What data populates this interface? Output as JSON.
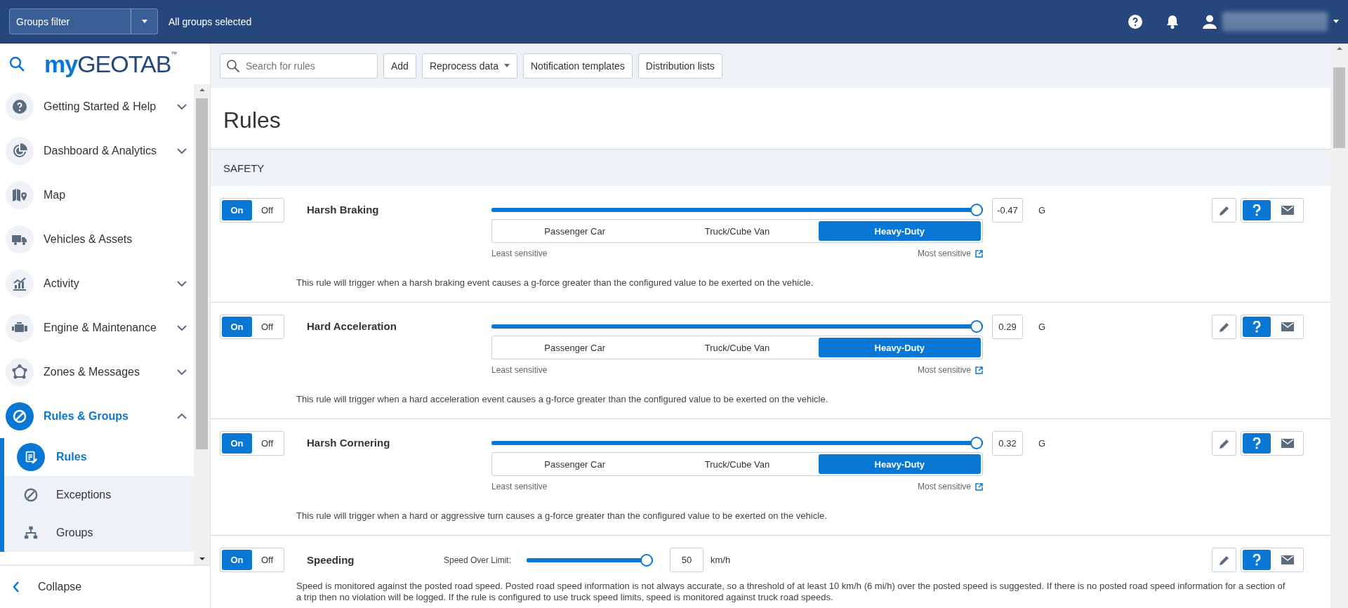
{
  "top_bar": {
    "groups_filter": "Groups filter",
    "groups_status": "All groups selected"
  },
  "sidebar": {
    "logo": {
      "prefix": "my",
      "name": "GEOTAB",
      "mark": "™"
    },
    "items": [
      {
        "label": "Getting Started & Help",
        "expandable": true,
        "expanded": false,
        "selected": false
      },
      {
        "label": "Dashboard & Analytics",
        "expandable": true,
        "expanded": false,
        "selected": false
      },
      {
        "label": "Map",
        "expandable": false,
        "selected": false
      },
      {
        "label": "Vehicles & Assets",
        "expandable": false,
        "selected": false
      },
      {
        "label": "Activity",
        "expandable": true,
        "expanded": false,
        "selected": false
      },
      {
        "label": "Engine & Maintenance",
        "expandable": true,
        "expanded": false,
        "selected": false
      },
      {
        "label": "Zones & Messages",
        "expandable": true,
        "expanded": false,
        "selected": false
      },
      {
        "label": "Rules & Groups",
        "expandable": true,
        "expanded": true,
        "selected": true,
        "children": [
          {
            "label": "Rules",
            "selected": true
          },
          {
            "label": "Exceptions",
            "selected": false
          },
          {
            "label": "Groups",
            "selected": false
          }
        ]
      }
    ],
    "collapse": "Collapse"
  },
  "toolbar": {
    "search": {
      "placeholder": "Search for rules"
    },
    "buttons": [
      {
        "label": "Add",
        "dropdown": false
      },
      {
        "label": "Reprocess data",
        "dropdown": true
      },
      {
        "label": "Notification templates",
        "dropdown": false
      },
      {
        "label": "Distribution lists",
        "dropdown": false
      }
    ]
  },
  "page_title": "Rules",
  "section": "SAFETY",
  "rules": [
    {
      "kind": "vehicle",
      "name": "Harsh Braking",
      "on": true,
      "on_label": "On",
      "off_label": "Off",
      "level": 1,
      "value": "-0.47",
      "unit": "G",
      "vehicle_types": [
        {
          "label": "Passenger Car",
          "selected": false
        },
        {
          "label": "Truck/Cube Van",
          "selected": false
        },
        {
          "label": "Heavy-Duty",
          "selected": true
        }
      ],
      "least_label": "Least sensitive",
      "most_label": "Most sensitive",
      "description": "This rule will trigger when a harsh braking event causes a g-force greater than the configured value to be exerted on the vehicle."
    },
    {
      "kind": "vehicle",
      "name": "Hard Acceleration",
      "on": true,
      "on_label": "On",
      "off_label": "Off",
      "level": 1,
      "value": "0.29",
      "unit": "G",
      "vehicle_types": [
        {
          "label": "Passenger Car",
          "selected": false
        },
        {
          "label": "Truck/Cube Van",
          "selected": false
        },
        {
          "label": "Heavy-Duty",
          "selected": true
        }
      ],
      "least_label": "Least sensitive",
      "most_label": "Most sensitive",
      "description": "This rule will trigger when a hard acceleration event causes a g-force greater than the configured value to be exerted on the vehicle."
    },
    {
      "kind": "vehicle",
      "name": "Harsh Cornering",
      "on": true,
      "on_label": "On",
      "off_label": "Off",
      "level": 1,
      "value": "0.32",
      "unit": "G",
      "vehicle_types": [
        {
          "label": "Passenger Car",
          "selected": false
        },
        {
          "label": "Truck/Cube Van",
          "selected": false
        },
        {
          "label": "Heavy-Duty",
          "selected": true
        }
      ],
      "least_label": "Least sensitive",
      "most_label": "Most sensitive",
      "description": "This rule will trigger when a hard or aggressive turn causes a g-force greater than the configured value to be exerted on the vehicle."
    },
    {
      "kind": "speed",
      "name": "Speeding",
      "on": true,
      "on_label": "On",
      "off_label": "Off",
      "slider_label": "Speed Over Limit:",
      "level": 1,
      "value": "50",
      "unit": "km/h",
      "description": "Speed is monitored against the posted road speed. Posted road speed information is not always accurate, so a threshold of at least 10 km/h (6 mi/h) over the posted speed is suggested. If there is no posted road speed information for a section of a trip then no violation will be logged. If the rule is configured to use truck speed limits, speed is monitored against truck road speeds."
    }
  ]
}
